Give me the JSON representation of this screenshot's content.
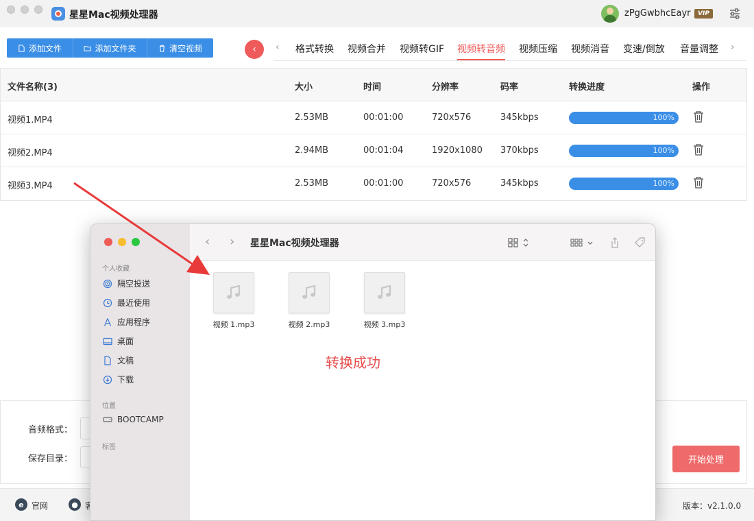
{
  "app": {
    "title": "星星Mac视频处理器",
    "username": "zPgGwbhcEayr",
    "vip": "VIP"
  },
  "toolbar": {
    "add_file": "添加文件",
    "add_folder": "添加文件夹",
    "clear": "清空视频"
  },
  "tabs": [
    {
      "label": "格式转换",
      "active": false
    },
    {
      "label": "视频合并",
      "active": false
    },
    {
      "label": "视频转GIF",
      "active": false
    },
    {
      "label": "视频转音频",
      "active": true
    },
    {
      "label": "视频压缩",
      "active": false
    },
    {
      "label": "视频消音",
      "active": false
    },
    {
      "label": "变速/倒放",
      "active": false
    },
    {
      "label": "音量调整",
      "active": false
    }
  ],
  "table": {
    "headers": [
      "文件名称(3)",
      "大小",
      "时间",
      "分辨率",
      "码率",
      "转换进度",
      "操作"
    ],
    "rows": [
      {
        "name": "视频1.MP4",
        "size": "2.53MB",
        "time": "00:01:00",
        "resolution": "720x576",
        "bitrate": "345kbps",
        "progress": "100%"
      },
      {
        "name": "视频2.MP4",
        "size": "2.94MB",
        "time": "00:01:04",
        "resolution": "1920x1080",
        "bitrate": "370kbps",
        "progress": "100%"
      },
      {
        "name": "视频3.MP4",
        "size": "2.53MB",
        "time": "00:01:00",
        "resolution": "720x576",
        "bitrate": "345kbps",
        "progress": "100%"
      }
    ]
  },
  "settings": {
    "audio_format_label": "音频格式：",
    "save_dir_label": "保存目录：",
    "start_button": "开始处理"
  },
  "footer": {
    "website": "官网",
    "service": "客",
    "version": "版本：v2.1.0.0"
  },
  "finder": {
    "title": "星星Mac视频处理器",
    "sections": {
      "favorites": "个人收藏",
      "locations": "位置",
      "tags": "标签"
    },
    "favorites": [
      "隔空投送",
      "最近使用",
      "应用程序",
      "桌面",
      "文稿",
      "下载"
    ],
    "locations": [
      "BOOTCAMP"
    ],
    "files": [
      "视频 1.mp3",
      "视频 2.mp3",
      "视频 3.mp3"
    ],
    "message": "转换成功"
  },
  "colors": {
    "accent_red": "#ef5a5a",
    "primary_blue": "#3a8ee6"
  }
}
